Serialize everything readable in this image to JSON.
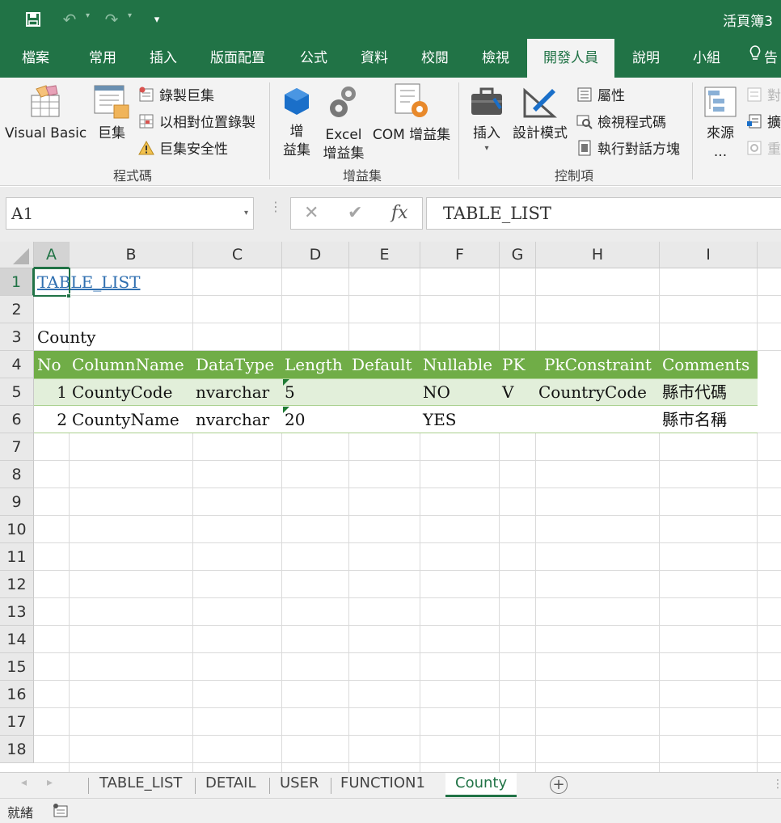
{
  "title_bar": {
    "doc_title": "活頁簿3",
    "save_icon": "save-icon",
    "undo_icon": "undo-icon",
    "redo_icon": "redo-icon"
  },
  "tabs": [
    "檔案",
    "常用",
    "插入",
    "版面配置",
    "公式",
    "資料",
    "校閱",
    "檢視",
    "開發人員",
    "說明",
    "小組",
    "告"
  ],
  "active_tab": "開發人員",
  "ribbon": {
    "code": {
      "group_label": "程式碼",
      "visual_basic": "Visual Basic",
      "macros": "巨集",
      "record_macro": "錄製巨集",
      "relative_ref": "以相對位置錄製",
      "macro_security": "巨集安全性"
    },
    "addins": {
      "group_label": "增益集",
      "addins_line1": "增",
      "addins_line2": "益集",
      "excel_addins_line1": "Excel",
      "excel_addins_line2": "增益集",
      "com_addins": "COM 增益集"
    },
    "controls": {
      "group_label": "控制項",
      "insert": "插入",
      "design_mode": "設計模式",
      "properties": "屬性",
      "view_code": "檢視程式碼",
      "run_dialog": "執行對話方塊"
    },
    "xml": {
      "source_line1": "來源",
      "source_line2": "...",
      "item1": "對",
      "item2": "擴",
      "item3": "重"
    }
  },
  "formula_bar": {
    "name_box": "A1",
    "cancel": "✕",
    "enter": "✔",
    "fx": "fx",
    "formula": "TABLE_LIST"
  },
  "columns": [
    "A",
    "B",
    "C",
    "D",
    "E",
    "F",
    "G",
    "H",
    "I"
  ],
  "rows": [
    "1",
    "2",
    "3",
    "4",
    "5",
    "6",
    "7",
    "8",
    "9",
    "10",
    "11",
    "12",
    "13",
    "14",
    "15",
    "16",
    "17",
    "18"
  ],
  "sheet": {
    "link_cell": "TABLE_LIST",
    "table_name": "County",
    "headers": [
      "No",
      "ColumnName",
      "DataType",
      "Length",
      "Default",
      "Nullable",
      "PK",
      "PkConstraint",
      "Comments"
    ],
    "records": [
      [
        "1",
        "CountyCode",
        "nvarchar",
        "5",
        "",
        "NO",
        "V",
        "CountryCode",
        "縣市代碼"
      ],
      [
        "2",
        "CountyName",
        "nvarchar",
        "20",
        "",
        "YES",
        "",
        "",
        "縣市名稱"
      ]
    ]
  },
  "sheet_tabs": [
    "TABLE_LIST",
    "DETAIL",
    "USER",
    "FUNCTION1",
    "County"
  ],
  "active_sheet": "County",
  "status": {
    "ready": "就緒"
  },
  "colors": {
    "excel_green": "#217346",
    "table_header": "#70ad47",
    "table_band": "#e2efda",
    "link": "#2f6fb0"
  }
}
